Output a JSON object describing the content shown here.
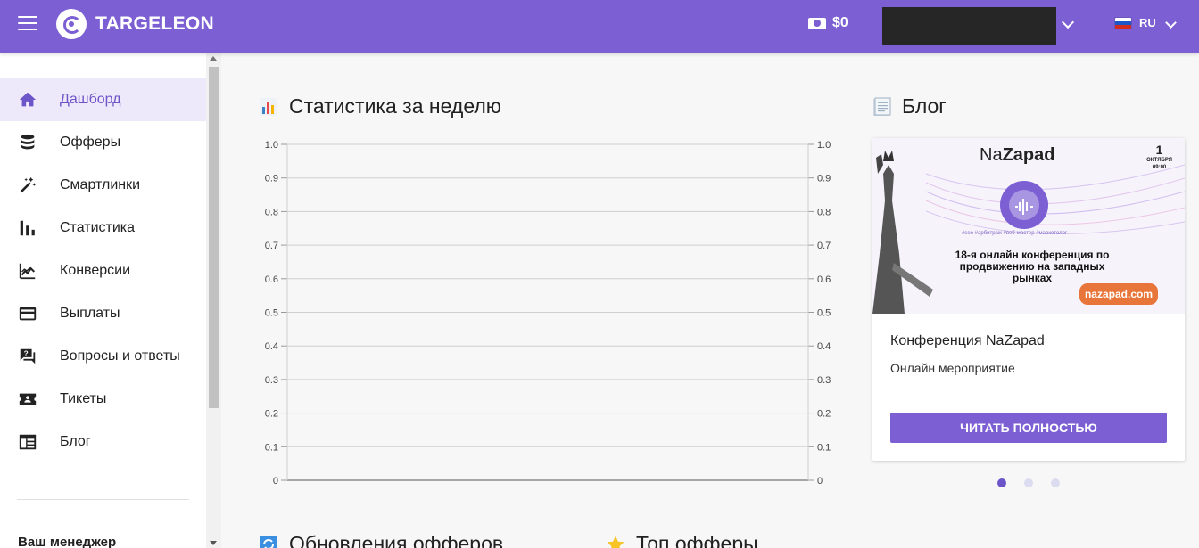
{
  "header": {
    "logo_text": "TARGELEON",
    "balance": "$0",
    "lang": "RU",
    "icons": [
      "menu-icon",
      "cash-icon",
      "chevron-down-icon",
      "russia-flag-icon"
    ],
    "colors": {
      "primary": "#7b5fd3",
      "active_bg": "#ede8fa",
      "active_text": "#6c55c9"
    }
  },
  "sidebar": {
    "items": [
      {
        "label": "Дашборд",
        "icon": "home-icon",
        "active": true
      },
      {
        "label": "Офферы",
        "icon": "database-icon"
      },
      {
        "label": "Смартлинки",
        "icon": "magic-wand-icon"
      },
      {
        "label": "Статистика",
        "icon": "bar-chart-icon"
      },
      {
        "label": "Конверсии",
        "icon": "trending-icon"
      },
      {
        "label": "Выплаты",
        "icon": "credit-card-icon"
      },
      {
        "label": "Вопросы и ответы",
        "icon": "question-answer-icon"
      },
      {
        "label": "Тикеты",
        "icon": "ticket-icon"
      },
      {
        "label": "Блог",
        "icon": "blog-icon"
      }
    ],
    "manager_label": "Ваш менеджер"
  },
  "main": {
    "stats_title": "Статистика за неделю",
    "blog_title": "Блог",
    "updates_title": "Обновления офферов",
    "top_title": "Топ офферы"
  },
  "blog_card": {
    "banner": {
      "brand_prefix": "Na",
      "brand_suffix": "Zapad",
      "date_day": "1",
      "date_month": "ОКТЯБРЯ",
      "date_time": "09:00",
      "tags": "#seo #арбитраж #веб-мастер #маркетолог",
      "headline": "18-я онлайн конференция по продвижению на западных рынках",
      "url": "nazapad.com"
    },
    "title": "Конференция NaZapad",
    "subtitle": "Онлайн мероприятие",
    "button": "ЧИТАТЬ ПОЛНОСТЬЮ",
    "slides": 3,
    "active_slide": 0
  },
  "chart_data": {
    "type": "line",
    "title": "Статистика за неделю",
    "x": [],
    "series": [],
    "ylim": [
      0,
      1
    ],
    "y_ticks": [
      "0",
      "0.1",
      "0.2",
      "0.3",
      "0.4",
      "0.5",
      "0.6",
      "0.7",
      "0.8",
      "0.9",
      "1.0"
    ],
    "y2_ticks": [
      "0",
      "0.1",
      "0.2",
      "0.3",
      "0.4",
      "0.5",
      "0.6",
      "0.7",
      "0.8",
      "0.9",
      "1.0"
    ],
    "grid": true
  }
}
